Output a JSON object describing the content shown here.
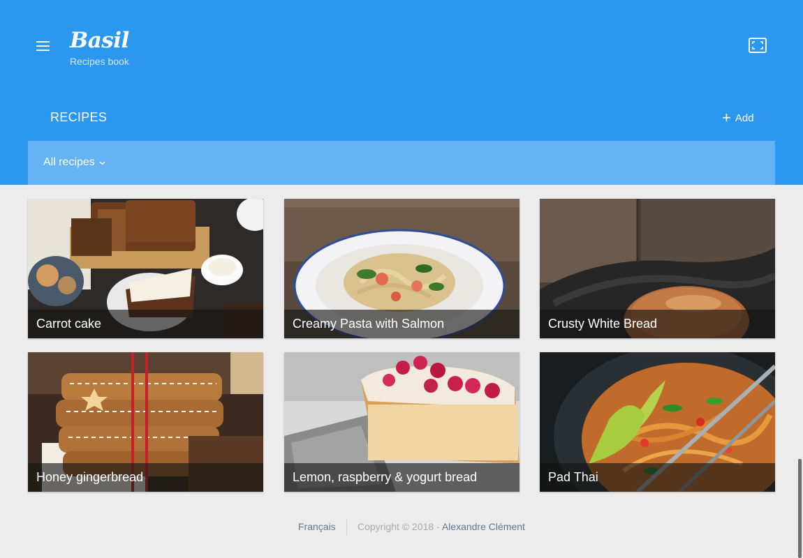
{
  "header": {
    "brand_title": "Basil",
    "brand_subtitle": "Recipes book",
    "menu_icon": "hamburger-icon",
    "fullscreen_icon": "fullscreen-icon",
    "section_title": "RECIPES",
    "add_label": "Add"
  },
  "filter": {
    "selected": "All recipes"
  },
  "recipes": [
    {
      "title": "Carrot cake"
    },
    {
      "title": "Creamy Pasta with Salmon"
    },
    {
      "title": "Crusty White Bread"
    },
    {
      "title": "Honey gingerbread"
    },
    {
      "title": "Lemon, raspberry & yogurt bread"
    },
    {
      "title": "Pad Thai"
    }
  ],
  "footer": {
    "language": "Français",
    "copyright": "Copyright © 2018 -",
    "author": "Alexandre Clément"
  },
  "colors": {
    "header_bg": "#2b97ef",
    "filter_bg": "#65b3f5",
    "page_bg": "#ececec",
    "link": "#5b7a94"
  }
}
